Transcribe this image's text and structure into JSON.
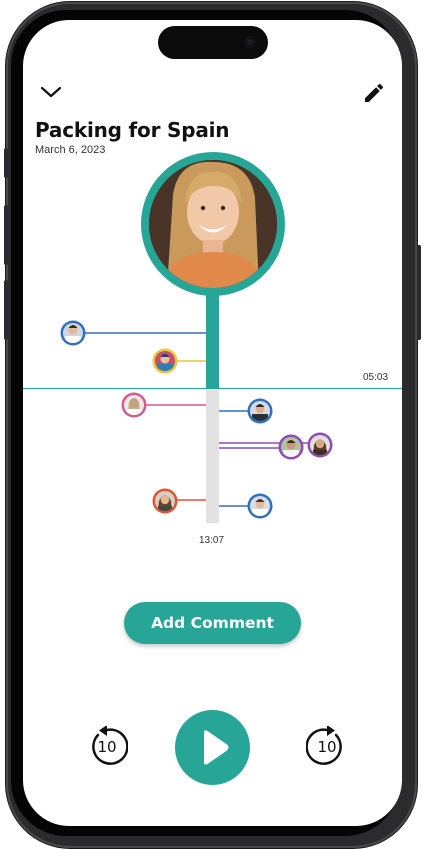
{
  "header": {
    "title": "Packing for Spain",
    "date": "March 6, 2023",
    "collapse_icon": "chevron-down-icon",
    "edit_icon": "pencil-icon"
  },
  "timeline": {
    "current_time": "05:03",
    "total_time": "13:07",
    "accent_color": "#27a596",
    "comment_colors": [
      "#2f6fc0",
      "#e8c53a",
      "#d8588f",
      "#8d4bb8",
      "#e0532f"
    ]
  },
  "actions": {
    "add_comment_label": "Add Comment"
  },
  "player": {
    "rewind_label": "10",
    "forward_label": "10",
    "play_icon": "play-icon"
  }
}
